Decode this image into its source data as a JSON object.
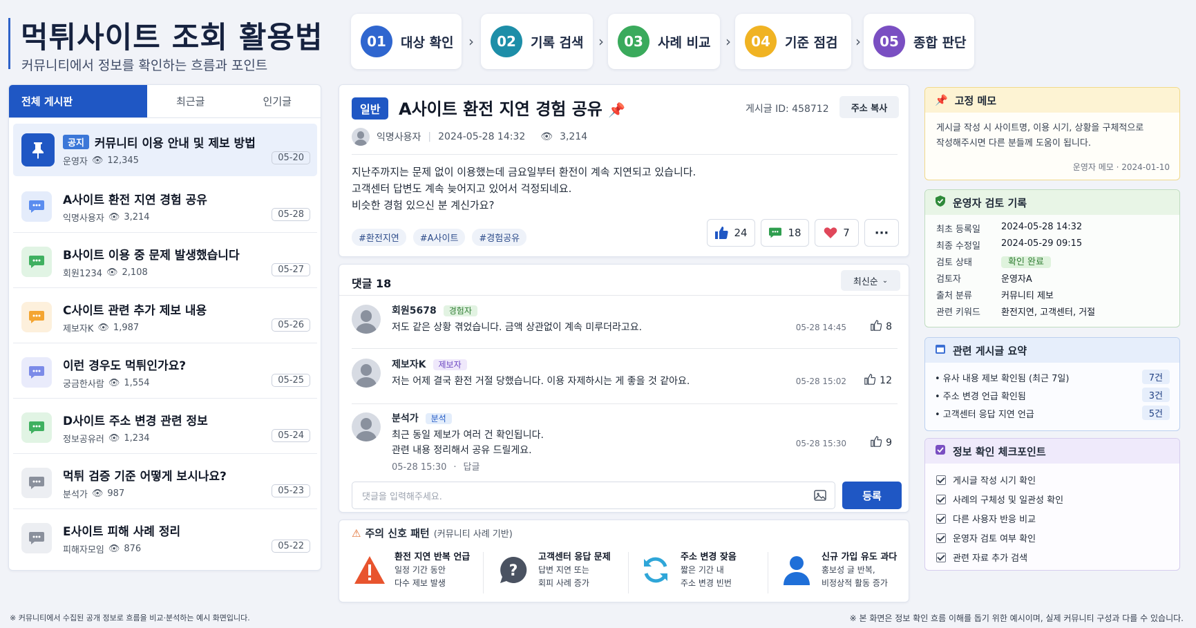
{
  "header": {
    "title": "먹튀사이트 조회 활용법",
    "subtitle": "커뮤니티에서 정보를 확인하는 흐름과 포인트"
  },
  "steps": [
    {
      "num": "01",
      "label": "대상 확인",
      "color": "#2f66cf"
    },
    {
      "num": "02",
      "label": "기록 검색",
      "color": "#1d8ea8"
    },
    {
      "num": "03",
      "label": "사례 비교",
      "color": "#3aaa5c"
    },
    {
      "num": "04",
      "label": "기준 점검",
      "color": "#f0b323"
    },
    {
      "num": "05",
      "label": "종합 판단",
      "color": "#7a4fc2"
    }
  ],
  "left": {
    "tabs": [
      "전체 게시판",
      "최근글",
      "인기글"
    ],
    "notice_label": "공지",
    "posts": [
      {
        "title": "커뮤니티 이용 안내 및 제보 방법",
        "author": "운영자",
        "views": "12,345",
        "date": "05-20",
        "icon": "pin-icon",
        "color": "#1f57c4",
        "bg": "#1f57c4"
      },
      {
        "title": "A사이트 환전 지연 경험 공유",
        "author": "익명사용자",
        "views": "3,214",
        "date": "05-28",
        "icon": "chat-icon",
        "color": "#5b8def",
        "bg": "#e4ecfb"
      },
      {
        "title": "B사이트 이용 중 문제 발생했습니다",
        "author": "회원1234",
        "views": "2,108",
        "date": "05-27",
        "icon": "chat-icon",
        "color": "#3fb060",
        "bg": "#e1f4e4"
      },
      {
        "title": "C사이트 관련 추가 제보 내용",
        "author": "제보자K",
        "views": "1,987",
        "date": "05-26",
        "icon": "chat-icon",
        "color": "#f4a531",
        "bg": "#fdf0dc"
      },
      {
        "title": "이런 경우도 먹튀인가요?",
        "author": "궁금한사람",
        "views": "1,554",
        "date": "05-25",
        "icon": "chat-icon",
        "color": "#7c8be8",
        "bg": "#e9ebfb"
      },
      {
        "title": "D사이트 주소 변경 관련 정보",
        "author": "정보공유러",
        "views": "1,234",
        "date": "05-24",
        "icon": "chat-icon",
        "color": "#3fb060",
        "bg": "#e1f4e4"
      },
      {
        "title": "먹튀 검증 기준 어떻게 보시나요?",
        "author": "분석가",
        "views": "987",
        "date": "05-23",
        "icon": "chat-icon",
        "color": "#8a909c",
        "bg": "#eceef2"
      },
      {
        "title": "E사이트 피해 사례 정리",
        "author": "피해자모임",
        "views": "876",
        "date": "05-22",
        "icon": "chat-icon",
        "color": "#8a909c",
        "bg": "#eceef2"
      }
    ]
  },
  "main": {
    "badge": "일반",
    "title": "A사이트 환전 지연 경험 공유",
    "post_id": "게시글 ID: 458712",
    "copy_button": "주소 복사",
    "author": "익명사용자",
    "datetime": "2024-05-28 14:32",
    "views": "3,214",
    "body": [
      "지난주까지는 문제 없이 이용했는데 금요일부터 환전이 계속 지연되고 있습니다.",
      "고객센터 답변도 계속 늦어지고 있어서 걱정되네요.",
      "비슷한 경험 있으신 분 계신가요?"
    ],
    "tags": [
      "#환전지연",
      "#A사이트",
      "#경험공유"
    ],
    "likes": "24",
    "comments_count": "18",
    "hearts": "7",
    "more": "···"
  },
  "comments": {
    "header": "댓글 18",
    "sort": "최신순",
    "items": [
      {
        "name": "회원5678",
        "label": "경험자",
        "label_bg": "#e2f3e2",
        "label_color": "#2f7d32",
        "text": [
          "저도 같은 상황 겪었습니다. 금액 상관없이 계속 미루더라고요."
        ],
        "time": "05-28 14:45",
        "likes": "8"
      },
      {
        "name": "제보자K",
        "label": "제보자",
        "label_bg": "#efe8fb",
        "label_color": "#6b46c1",
        "text": [
          "저는 어제 결국 환전 거절 당했습니다. 이용 자제하시는 게 좋을 것 같아요."
        ],
        "time": "05-28 15:02",
        "likes": "12"
      },
      {
        "name": "분석가",
        "label": "분석",
        "label_bg": "#e3edfb",
        "label_color": "#1f57c4",
        "text": [
          "최근 동일 제보가 여러 건 확인됩니다.",
          "관련 내용 정리해서 공유 드릴게요."
        ],
        "time": "05-28 15:30",
        "likes": "9",
        "sub_time": "05-28 15:30",
        "reply": "답글"
      }
    ],
    "input_placeholder": "댓글을 입력해주세요.",
    "submit": "등록"
  },
  "warnings": {
    "title": "주의 신호 패턴",
    "subtitle": "(커뮤니티 사례 기반)",
    "items": [
      {
        "title": "환전 지연 반복 언급",
        "desc": [
          "일정 기간 동안",
          "다수 제보 발생"
        ],
        "icon": "warning-triangle-icon"
      },
      {
        "title": "고객센터 응답 문제",
        "desc": [
          "답변 지연 또는",
          "회피 사례 증가"
        ],
        "icon": "question-bubble-icon"
      },
      {
        "title": "주소 변경 잦음",
        "desc": [
          "짧은 기간 내",
          "주소 변경 빈번"
        ],
        "icon": "refresh-icon"
      },
      {
        "title": "신규 가입 유도 과다",
        "desc": [
          "홍보성 글 반복,",
          "비정상적 활동 증가"
        ],
        "icon": "user-icon"
      }
    ]
  },
  "memo": {
    "title": "고정 메모",
    "text": [
      "게시글 작성 시 사이트명, 이용 시기, 상황을 구체적으로",
      "작성해주시면 다른 분들께 도움이 됩니다."
    ],
    "signature": "운영자 메모 · 2024-01-10"
  },
  "review": {
    "title": "운영자 검토 기록",
    "rows": [
      {
        "label": "최초 등록일",
        "value": "2024-05-28 14:32"
      },
      {
        "label": "최종 수정일",
        "value": "2024-05-29 09:15"
      },
      {
        "label": "검토 상태",
        "value": "확인 완료"
      },
      {
        "label": "검토자",
        "value": "운영자A"
      },
      {
        "label": "출처 분류",
        "value": "커뮤니티 제보"
      },
      {
        "label": "관련 키워드",
        "value": "환전지연, 고객센터, 거절"
      }
    ]
  },
  "related": {
    "title": "관련 게시글 요약",
    "rows": [
      {
        "label": "• 유사 내용 제보 확인됨 (최근 7일)",
        "count": "7건"
      },
      {
        "label": "• 주소 변경 언급 확인됨",
        "count": "3건"
      },
      {
        "label": "• 고객센터 응답 지연 언급",
        "count": "5건"
      }
    ]
  },
  "checklist": {
    "title": "정보 확인 체크포인트",
    "items": [
      "게시글 작성 시기 확인",
      "사례의 구체성 및 일관성 확인",
      "다른 사용자 반응 비교",
      "운영자 검토 여부 확인",
      "관련 자료 추가 검색"
    ]
  },
  "footer": {
    "left": "※ 커뮤니티에서 수집된 공개 정보로 흐름을 비교·분석하는 예시 화면입니다.",
    "right": "※ 본 화면은 정보 확인 흐름 이해를 돕기 위한 예시이며, 실제 커뮤니티 구성과 다를 수 있습니다."
  }
}
